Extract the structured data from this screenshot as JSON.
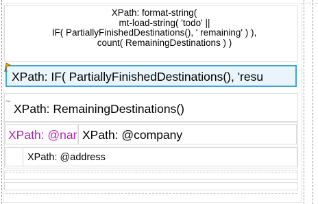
{
  "header_expression": {
    "lines": [
      "XPath: format-string(",
      "        mt-load-string( 'todo' ||",
      "IF( PartiallyFinishedDestinations(), ' remaining' ) ),",
      "        count( RemainingDestinations ) )"
    ]
  },
  "selected_field": {
    "text": "XPath: IF( PartiallyFinishedDestinations(), 'resu",
    "marker_icon": "condition-flag-icon",
    "border_color": "#3aa7d6"
  },
  "count_field": {
    "text": "XPath: RemainingDestinations()",
    "marker_icon": "repeat-tilde-icon"
  },
  "name_field": {
    "text": "XPath: @name",
    "color": "#b21fb0"
  },
  "company_field": {
    "text": "XPath: @company"
  },
  "address_field": {
    "text": "XPath: @address"
  }
}
